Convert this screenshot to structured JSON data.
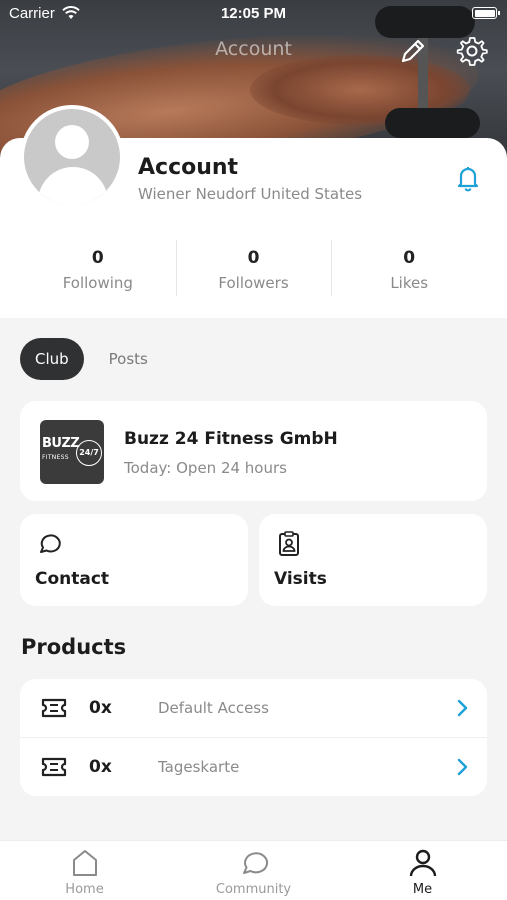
{
  "status_bar": {
    "carrier": "Carrier",
    "time": "12:05 PM"
  },
  "header": {
    "title": "Account"
  },
  "profile": {
    "name": "Account",
    "location": "Wiener Neudorf United States",
    "stats": [
      {
        "value": "0",
        "label": "Following"
      },
      {
        "value": "0",
        "label": "Followers"
      },
      {
        "value": "0",
        "label": "Likes"
      }
    ]
  },
  "tabs": [
    {
      "label": "Club",
      "active": true
    },
    {
      "label": "Posts",
      "active": false
    }
  ],
  "club": {
    "name": "Buzz 24 Fitness GmbH",
    "hours": "Today: Open 24 hours",
    "logo_text": "BUZZ",
    "logo_sub": "FITNESS",
    "logo_badge": "24/7"
  },
  "tiles": {
    "contact": "Contact",
    "visits": "Visits"
  },
  "products": {
    "title": "Products",
    "items": [
      {
        "qty": "0x",
        "name": "Default Access"
      },
      {
        "qty": "0x",
        "name": "Tageskarte"
      }
    ]
  },
  "bottom_nav": [
    {
      "label": "Home",
      "icon": "home-icon"
    },
    {
      "label": "Community",
      "icon": "chat-bubble-icon"
    },
    {
      "label": "Me",
      "icon": "person-icon",
      "active": true
    }
  ],
  "colors": {
    "accent": "#1da1d6",
    "active_tab": "#2f3133"
  }
}
